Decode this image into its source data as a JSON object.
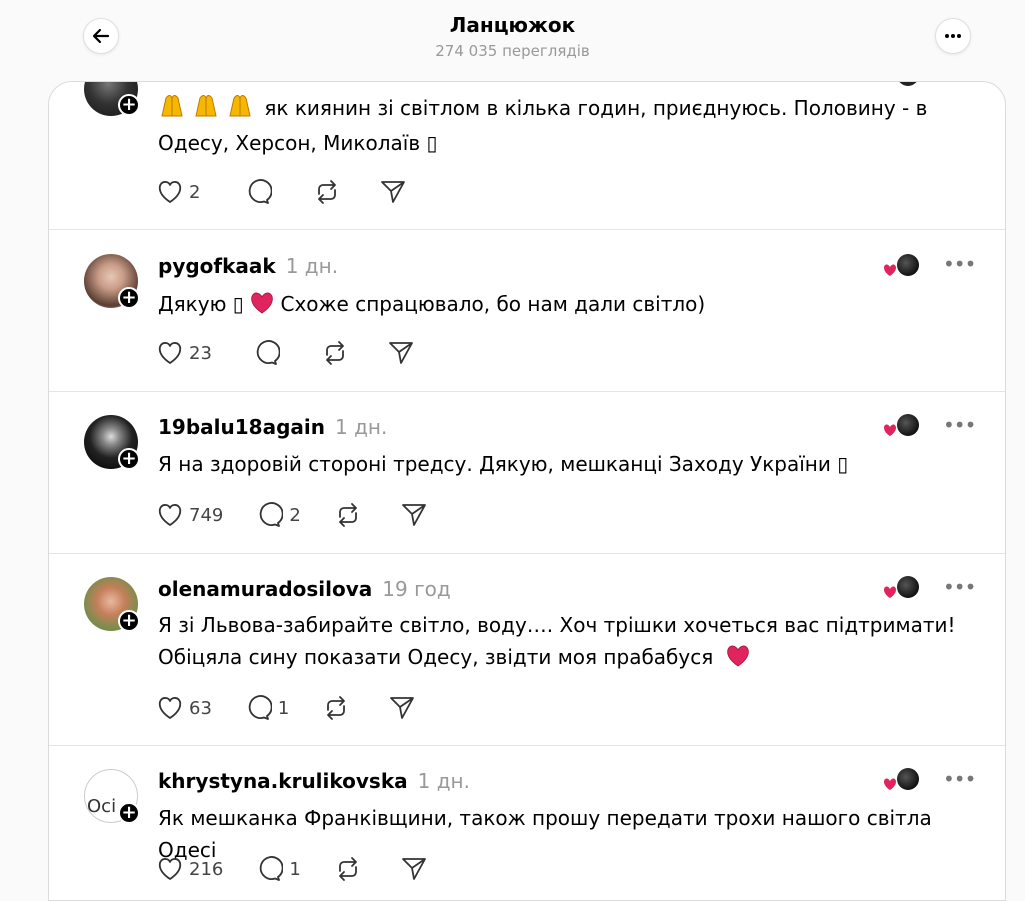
{
  "header": {
    "title": "Ланцюжок",
    "views": "274 035 переглядів"
  },
  "posts": [
    {
      "username": "",
      "time": "",
      "text_lines": [
        "як киянин зі світлом в кілька годин, приєднуюсь. Половину - в",
        "Одесу, Херсон, Миколаїв ▯"
      ],
      "likes": "2",
      "replies": "",
      "reposts": ""
    },
    {
      "username": "pygofkaak",
      "time": "1 дн.",
      "text_lines": [
        "Дякую ▯",
        "Схоже спрацювало, бо нам дали світло)"
      ],
      "likes": "23",
      "replies": "",
      "reposts": ""
    },
    {
      "username": "19balu18again",
      "time": "1 дн.",
      "text_lines": [
        "Я на здоровій стороні тредсу. Дякую, мешканці Заходу України ▯"
      ],
      "likes": "749",
      "replies": "2",
      "reposts": ""
    },
    {
      "username": "olenamuradosilova",
      "time": "19 год",
      "text_lines": [
        "Я зі Львова-забирайте світло, воду…. Хоч трішки хочеться вас підтримати!",
        "Обіцяла сину показати Одесу, звідти моя прабабуся"
      ],
      "likes": "63",
      "replies": "1",
      "reposts": ""
    },
    {
      "username": "khrystyna.krulikovska",
      "time": "1 дн.",
      "avatar_alt": "Осі",
      "text_lines": [
        "Як мешканка Франківщини, також прошу передати трохи нашого світла Одесі"
      ],
      "likes": "216",
      "replies": "1",
      "reposts": ""
    }
  ],
  "colors": {
    "heart": "#e0245e",
    "muted": "#999999",
    "border": "#dbdbdb"
  },
  "icons": [
    "back-arrow-icon",
    "more-icon",
    "heart-icon",
    "reply-icon",
    "repost-icon",
    "share-icon",
    "follow-plus-icon",
    "heart-emoji-icon",
    "pray-emoji-icon"
  ]
}
